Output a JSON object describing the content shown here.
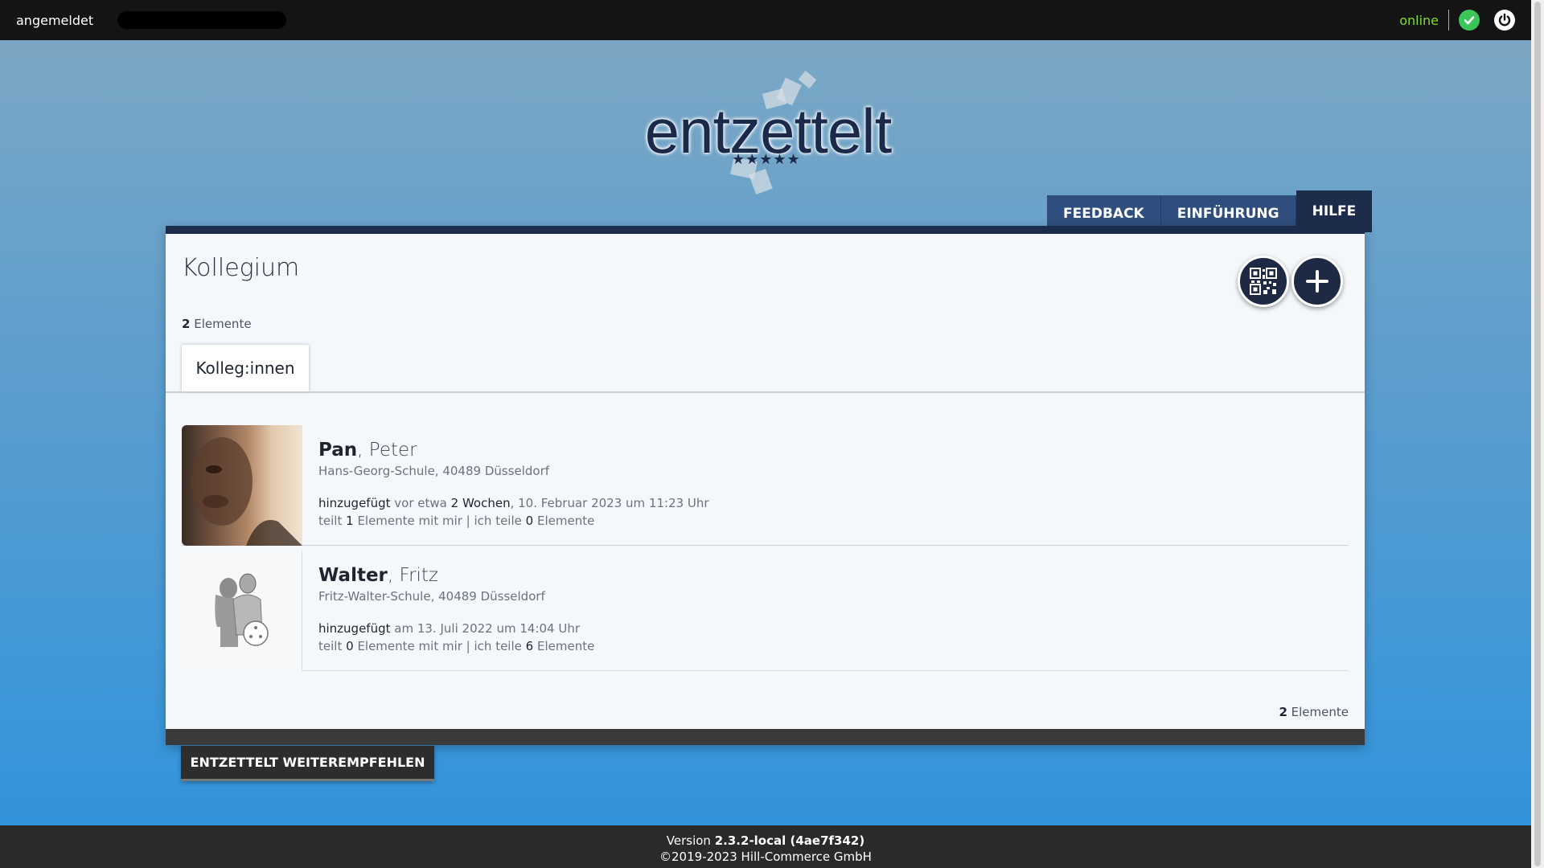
{
  "topbar": {
    "user_label": "angemeldet",
    "status": "online",
    "status_color": "#7ddc3a"
  },
  "logo": {
    "text": "entzettelt",
    "stars": "★★★★★"
  },
  "nav": {
    "tabs": [
      {
        "label": "FEEDBACK"
      },
      {
        "label": "EINFÜHRUNG"
      },
      {
        "label": "HILFE",
        "active": true
      }
    ]
  },
  "main": {
    "title": "Kollegium",
    "count_top": {
      "number": "2",
      "label": "Elemente"
    },
    "subtab": "Kolleg:innen",
    "colleagues": [
      {
        "last_name": "Pan",
        "first_name": "Peter",
        "school": "Hans-Georg-Schule, 40489 Düsseldorf",
        "added_label": "hinzugefügt",
        "added_prefix": "vor etwa",
        "added_relative": "2 Wochen",
        "added_date": ", 10. Februar 2023 um 11:23 Uhr",
        "shares_prefix": "teilt",
        "shares_with_me": "1",
        "shares_mid": "Elemente mit mir | ich teile",
        "shares_by_me": "0",
        "shares_suffix": "Elemente"
      },
      {
        "last_name": "Walter",
        "first_name": "Fritz",
        "school": "Fritz-Walter-Schule, 40489 Düsseldorf",
        "added_label": "hinzugefügt",
        "added_prefix": "am 13. Juli 2022 um 14:04 Uhr",
        "shares_prefix": "teilt",
        "shares_with_me": "0",
        "shares_mid": "Elemente mit mir | ich teile",
        "shares_by_me": "6",
        "shares_suffix": "Elemente"
      }
    ],
    "count_bottom": {
      "number": "2",
      "label": "Elemente"
    }
  },
  "recommend_button": "ENTZETTELT WEITEREMPFEHLEN",
  "footer": {
    "version_label": "Version",
    "version": "2.3.2-local (4ae7f342)",
    "copyright": "©2019-2023 Hill-Commerce GmbH"
  },
  "colors": {
    "navy": "#1c2d4c",
    "tab_blue": "#2f4e7d",
    "success": "#3cc65a"
  }
}
